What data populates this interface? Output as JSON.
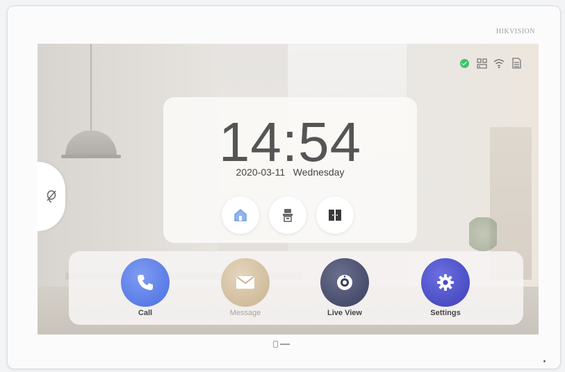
{
  "device": {
    "brand": "HIKVISION"
  },
  "clock": {
    "time": "14:54",
    "date": "2020-03-11",
    "weekday": "Wednesday"
  },
  "quick_actions": [
    {
      "icon": "home-icon"
    },
    {
      "icon": "guard-station-icon"
    },
    {
      "icon": "door-panel-icon"
    }
  ],
  "apps": {
    "call": {
      "label": "Call",
      "icon": "phone-icon",
      "color": "#4a6fe0"
    },
    "message": {
      "label": "Message",
      "icon": "envelope-icon",
      "color": "#c9b38f"
    },
    "live_view": {
      "label": "Live View",
      "icon": "camera-icon",
      "color": "#3b3f5e"
    },
    "settings": {
      "label": "Settings",
      "icon": "gear-icon",
      "color": "#3f3fb8"
    }
  },
  "status_icons": [
    "security-armed-icon",
    "network-icon",
    "wifi-icon",
    "sd-card-icon"
  ],
  "colors": {
    "armed": "#3cc46a"
  }
}
